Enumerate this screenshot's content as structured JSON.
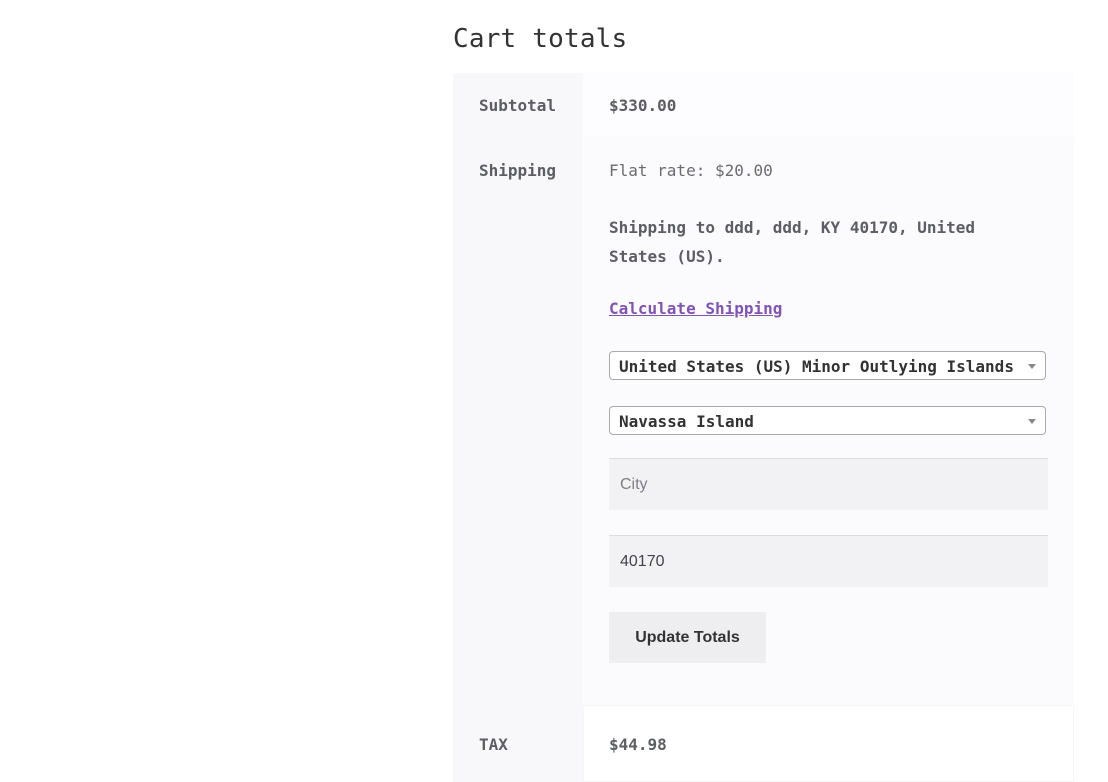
{
  "cart": {
    "title": "Cart totals",
    "subtotal": {
      "label": "Subtotal",
      "value": "$330.00"
    },
    "shipping": {
      "label": "Shipping",
      "method": "Flat rate: $20.00",
      "destination": "Shipping to ddd, ddd, KY 40170, United States (US).",
      "calculate_link": "Calculate Shipping",
      "country_selected": "United States (US) Minor Outlying Islands",
      "state_selected": "Navassa Island",
      "city_placeholder": "City",
      "city_value": "",
      "postcode_value": "40170",
      "update_button": "Update Totals"
    },
    "tax": {
      "label": "TAX",
      "value": "$44.98"
    }
  },
  "colors": {
    "link": "#7f54b3",
    "label_bg": "#f8f7fa",
    "input_bg": "#f2f1f4",
    "button_bg": "#eeedf0"
  }
}
